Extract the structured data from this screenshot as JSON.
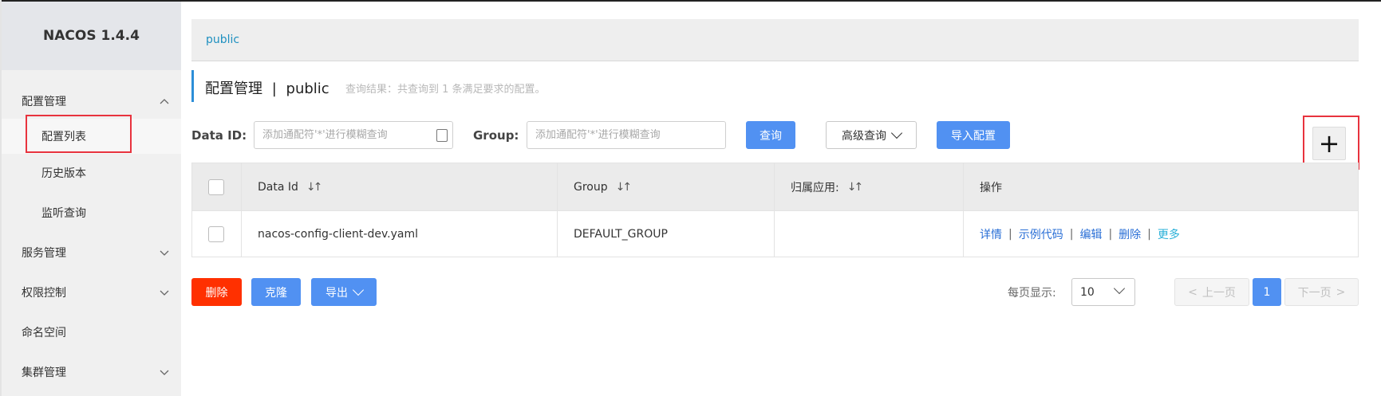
{
  "app": {
    "brand": "NACOS 1.4.4"
  },
  "sidebar": {
    "groups": [
      {
        "label": "配置管理",
        "expanded": true
      },
      {
        "label": "服务管理",
        "expanded": false
      },
      {
        "label": "权限控制",
        "expanded": false
      },
      {
        "label": "命名空间"
      },
      {
        "label": "集群管理",
        "expanded": false
      }
    ],
    "config_items": [
      {
        "label": "配置列表",
        "active": true
      },
      {
        "label": "历史版本"
      },
      {
        "label": "监听查询"
      }
    ]
  },
  "namespace_bar": {
    "current": "public"
  },
  "header": {
    "title": "配置管理",
    "separator": "|",
    "namespace": "public",
    "result_text": "查询结果：共查询到 1 条满足要求的配置。"
  },
  "search": {
    "data_id_label": "Data ID:",
    "data_id_placeholder": "添加通配符'*'进行模糊查询",
    "group_label": "Group:",
    "group_placeholder": "添加通配符'*'进行模糊查询",
    "query_button": "查询",
    "advanced_button": "高级查询",
    "import_button": "导入配置",
    "add_button": "+"
  },
  "table": {
    "columns": [
      "Data Id",
      "Group",
      "归属应用:",
      "操作"
    ],
    "rows": [
      {
        "data_id": "nacos-config-client-dev.yaml",
        "group": "DEFAULT_GROUP",
        "app": "",
        "ops": [
          "详情",
          "示例代码",
          "编辑",
          "删除",
          "更多"
        ]
      }
    ]
  },
  "bulk": {
    "delete": "删除",
    "clone": "克隆",
    "export": "导出"
  },
  "pagination": {
    "page_size_label": "每页显示:",
    "page_size": "10",
    "prev": "上一页",
    "current_page": "1",
    "next": "下一页"
  },
  "colors": {
    "primary": "#5191f2",
    "danger": "#ff3000",
    "highlight": "#e8333e",
    "accent_bar": "#2c8ed8"
  }
}
